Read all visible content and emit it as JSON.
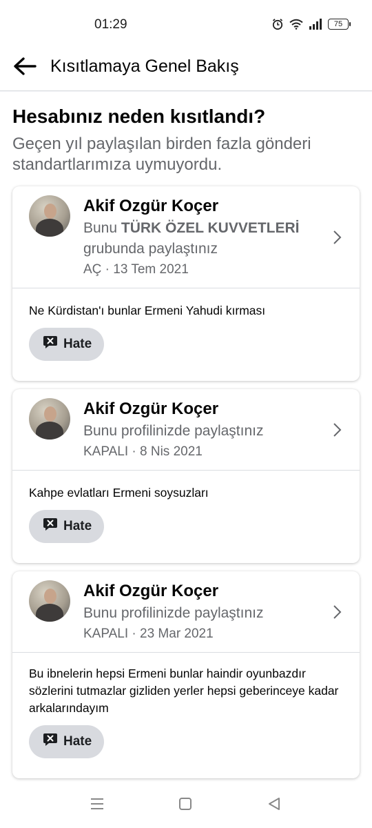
{
  "status_bar": {
    "time": "01:29",
    "battery": "75",
    "icons": [
      "alarm-icon",
      "wifi-icon",
      "signal-icon",
      "battery-icon"
    ]
  },
  "header": {
    "title": "Kısıtlamaya Genel Bakış",
    "back_icon": "arrow-left-icon"
  },
  "main": {
    "heading": "Hesabınız neden kısıtlandı?",
    "subheading": "Geçen yıl paylaşılan birden fazla gönderi standartlarımıza uymuyordu.",
    "posts": [
      {
        "author": "Akif Ozgür Koçer",
        "meta_prefix": "Bunu",
        "meta_group": "TÜRK ÖZEL KUVVETLERİ",
        "meta_suffix": "grubunda paylaştınız",
        "date": "AÇ · 13 Tem 2021",
        "text": "Ne Kürdistan'ı bunlar Ermeni Yahudi kırması",
        "tag": "Hate"
      },
      {
        "author": "Akif Ozgür Koçer",
        "meta": "Bunu profilinizde paylaştınız",
        "date": "KAPALI · 8 Nis 2021",
        "text": "Kahpe evlatları Ermeni soysuzları",
        "tag": "Hate"
      },
      {
        "author": "Akif Ozgür Koçer",
        "meta": "Bunu profilinizde paylaştınız",
        "date": "KAPALI · 23 Mar 2021",
        "text": "Bu ibnelerin hepsi Ermeni bunlar haindir oyunbazdır sözlerini tutmazlar gizliden yerler hepsi geberinceye kadar arkalarındayım",
        "tag": "Hate"
      }
    ]
  },
  "nav": {
    "icons": [
      "menu-icon",
      "home-square-icon",
      "back-triangle-icon"
    ]
  },
  "colors": {
    "text_primary": "#050505",
    "text_secondary": "#65676b",
    "tag_bg": "#d8dadf",
    "divider": "#dadde1"
  }
}
